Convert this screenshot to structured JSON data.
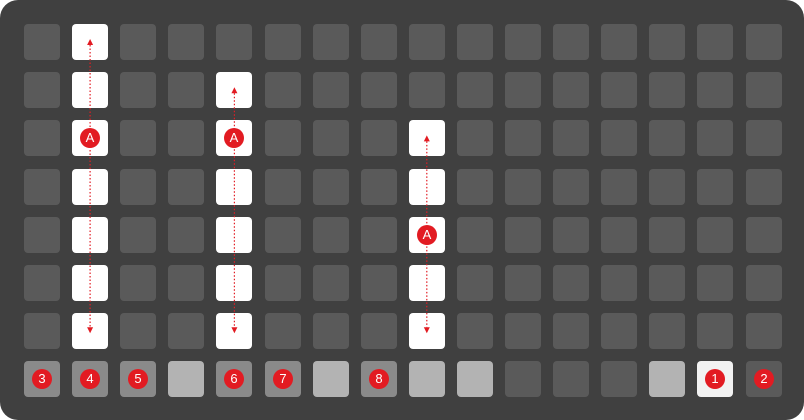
{
  "colors": {
    "board": "#404040",
    "cell_default": "#5a5a5a",
    "cell_lit": "#ffffff",
    "cell_light_gray": "#b3b3b3",
    "cell_mid_gray": "#8a8a8a",
    "cell_bright_bottom": "#f2f2f2",
    "accent_red": "#e21b22"
  },
  "grid": {
    "columns": 16,
    "rows": 8
  },
  "lit_cells": [
    {
      "col": 1,
      "row": 0
    },
    {
      "col": 1,
      "row": 1
    },
    {
      "col": 1,
      "row": 2
    },
    {
      "col": 1,
      "row": 3
    },
    {
      "col": 1,
      "row": 4
    },
    {
      "col": 1,
      "row": 5
    },
    {
      "col": 1,
      "row": 6
    },
    {
      "col": 4,
      "row": 1
    },
    {
      "col": 4,
      "row": 2
    },
    {
      "col": 4,
      "row": 3
    },
    {
      "col": 4,
      "row": 4
    },
    {
      "col": 4,
      "row": 5
    },
    {
      "col": 4,
      "row": 6
    },
    {
      "col": 8,
      "row": 2
    },
    {
      "col": 8,
      "row": 3
    },
    {
      "col": 8,
      "row": 4
    },
    {
      "col": 8,
      "row": 5
    },
    {
      "col": 8,
      "row": 6
    }
  ],
  "bottom_row_styles": [
    "mid",
    "mid",
    "mid",
    "light",
    "mid",
    "mid",
    "light",
    "mid",
    "light",
    "light",
    "default",
    "default",
    "default",
    "light",
    "bright",
    "default"
  ],
  "arrows": [
    {
      "col": 1,
      "from_row": 0,
      "to_row": 6
    },
    {
      "col": 4,
      "from_row": 1,
      "to_row": 6
    },
    {
      "col": 8,
      "from_row": 2,
      "to_row": 6
    }
  ],
  "a_badges": [
    {
      "col": 1,
      "row": 2,
      "label": "A"
    },
    {
      "col": 4,
      "row": 2,
      "label": "A"
    },
    {
      "col": 8,
      "row": 4,
      "label": "A"
    }
  ],
  "number_badges": [
    {
      "col": 0,
      "label": "3"
    },
    {
      "col": 1,
      "label": "4"
    },
    {
      "col": 2,
      "label": "5"
    },
    {
      "col": 4,
      "label": "6"
    },
    {
      "col": 5,
      "label": "7"
    },
    {
      "col": 7,
      "label": "8"
    },
    {
      "col": 14,
      "label": "1"
    },
    {
      "col": 15,
      "label": "2"
    }
  ]
}
